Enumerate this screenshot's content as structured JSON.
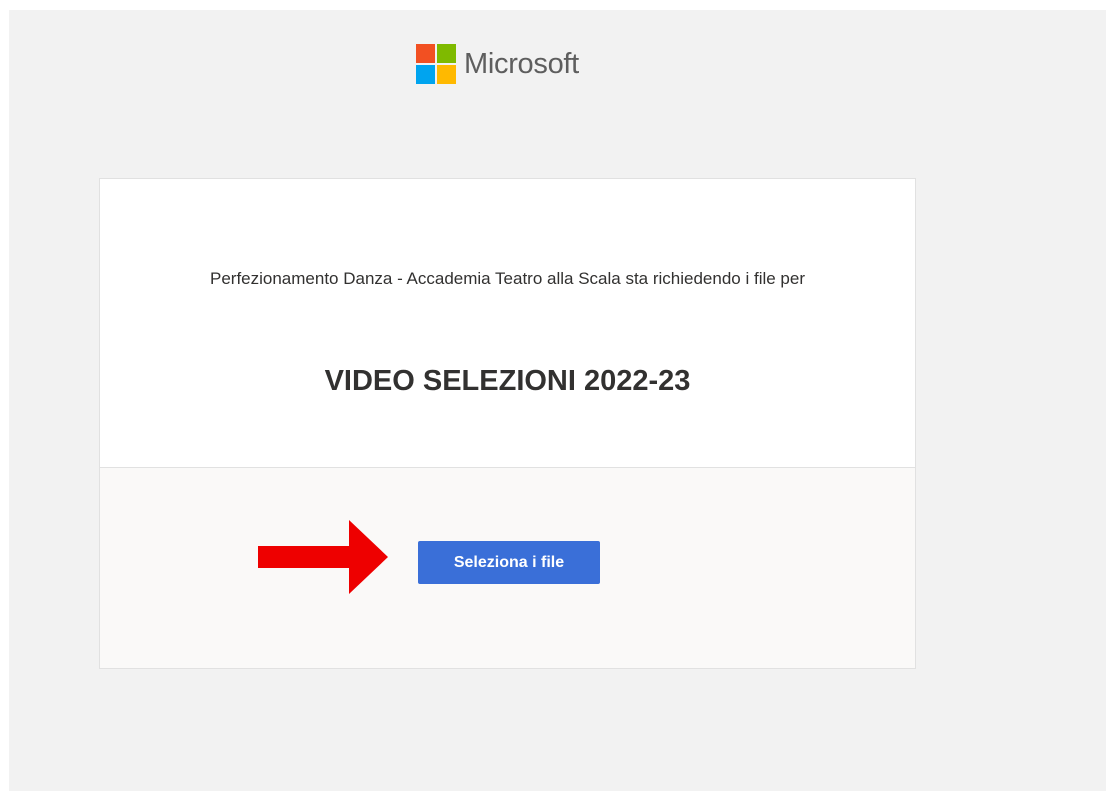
{
  "brand": {
    "name": "Microsoft",
    "logo_colors": [
      "#f25022",
      "#7fba00",
      "#00a4ef",
      "#ffb900"
    ]
  },
  "request": {
    "requester_text": "Perfezionamento Danza - Accademia Teatro alla Scala sta richiedendo i file per",
    "title": "VIDEO SELEZIONI 2022-23"
  },
  "actions": {
    "select_files_label": "Seleziona i file"
  },
  "annotation": {
    "arrow_color": "#ee0000"
  },
  "colors": {
    "button": "#3a6fd8",
    "background": "#f2f2f2"
  }
}
